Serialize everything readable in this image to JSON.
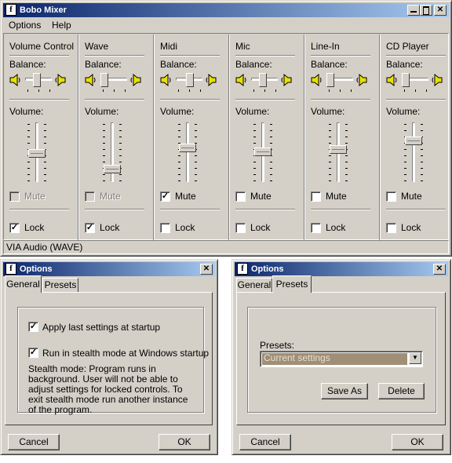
{
  "mixer": {
    "title": "Bobo Mixer",
    "menu": [
      "Options",
      "Help"
    ],
    "balance_label": "Balance:",
    "volume_label": "Volume:",
    "mute_label": "Mute",
    "lock_label": "Lock",
    "channels": [
      {
        "name": "Volume Control",
        "balance": 0.4,
        "volume": 0.48,
        "mute": false,
        "mute_enabled": false,
        "lock": true
      },
      {
        "name": "Wave",
        "balance": 0.0,
        "volume": 0.17,
        "mute": false,
        "mute_enabled": false,
        "lock": true
      },
      {
        "name": "Midi",
        "balance": 0.55,
        "volume": 0.58,
        "mute": true,
        "mute_enabled": true,
        "lock": false
      },
      {
        "name": "Mic",
        "balance": 0.4,
        "volume": 0.51,
        "mute": false,
        "mute_enabled": true,
        "lock": false
      },
      {
        "name": "Line-In",
        "balance": 0.0,
        "volume": 0.56,
        "mute": false,
        "mute_enabled": true,
        "lock": false
      },
      {
        "name": "CD Player",
        "balance": 0.0,
        "volume": 0.72,
        "mute": false,
        "mute_enabled": true,
        "lock": false
      }
    ],
    "status": "VIA Audio (WAVE)"
  },
  "options_general": {
    "title": "Options",
    "tabs": [
      "General",
      "Presets"
    ],
    "active_tab": "General",
    "apply_last_label": "Apply last settings at startup",
    "apply_last_checked": true,
    "stealth_label": "Run in stealth mode at Windows startup",
    "stealth_checked": true,
    "description": "Stealth mode: Program runs in background. User will not be able to adjust settings for locked controls. To exit stealth mode run another instance of the program.",
    "cancel_label": "Cancel",
    "ok_label": "OK"
  },
  "options_presets": {
    "title": "Options",
    "tabs": [
      "General",
      "Presets"
    ],
    "active_tab": "Presets",
    "presets_label": "Presets:",
    "presets_value": "Current settings",
    "save_as_label": "Save As",
    "delete_label": "Delete",
    "cancel_label": "Cancel",
    "ok_label": "OK"
  },
  "icons": {
    "app": "mixer-app-icon",
    "speaker": "speaker-icon",
    "minimize": "minimize-icon",
    "maximize": "maximize-icon",
    "close": "close-icon",
    "dropdown": "chevron-down-icon"
  },
  "colors": {
    "titlebar_start": "#0a246a",
    "titlebar_end": "#a6caf0",
    "face": "#d4d0c8",
    "speaker": "#e8e000",
    "preset_highlight": "#a08e76"
  }
}
